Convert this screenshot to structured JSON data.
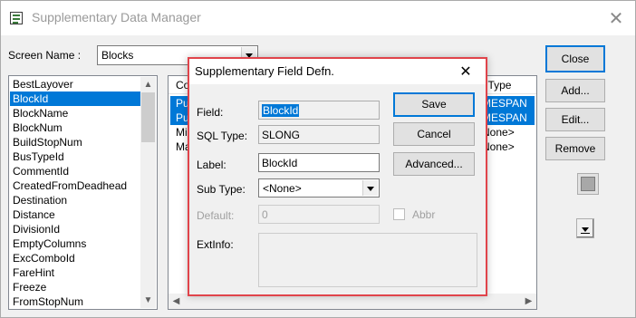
{
  "window": {
    "title": "Supplementary Data Manager",
    "close_glyph": "✕"
  },
  "screen": {
    "label": "Screen Name :",
    "selected": "Blocks"
  },
  "field_list": {
    "items": [
      "BestLayover",
      "BlockId",
      "BlockName",
      "BlockNum",
      "BuildStopNum",
      "BusTypeId",
      "CommentId",
      "CreatedFromDeadhead",
      "Destination",
      "Distance",
      "DivisionId",
      "EmptyColumns",
      "ExcComboId",
      "FareHint",
      "Freeze",
      "FromStopNum"
    ],
    "selected_index": 1
  },
  "grid": {
    "header_left": "Co",
    "header_right": "xt Type",
    "left_cells": [
      "Pu",
      "Pu",
      "Mi",
      "Ma"
    ],
    "right_cells": [
      "MESPAN",
      "MESPAN",
      "None>",
      "None>"
    ]
  },
  "buttons": {
    "close": "Close",
    "add": "Add...",
    "edit": "Edit...",
    "remove": "Remove"
  },
  "dialog": {
    "title": "Supplementary Field Defn.",
    "close_glyph": "✕",
    "field_label": "Field:",
    "field_value": "BlockId",
    "sql_type_label": "SQL Type:",
    "sql_type_value": "SLONG",
    "label_label": "Label:",
    "label_value": "BlockId",
    "sub_type_label": "Sub Type:",
    "sub_type_value": "<None>",
    "default_label": "Default:",
    "default_value": "0",
    "abbr_label": "Abbr",
    "extinfo_label": "ExtInfo:",
    "save": "Save",
    "cancel": "Cancel",
    "advanced": "Advanced..."
  },
  "colors": {
    "selection": "#0078d7",
    "dialog_border": "#e0444b"
  }
}
